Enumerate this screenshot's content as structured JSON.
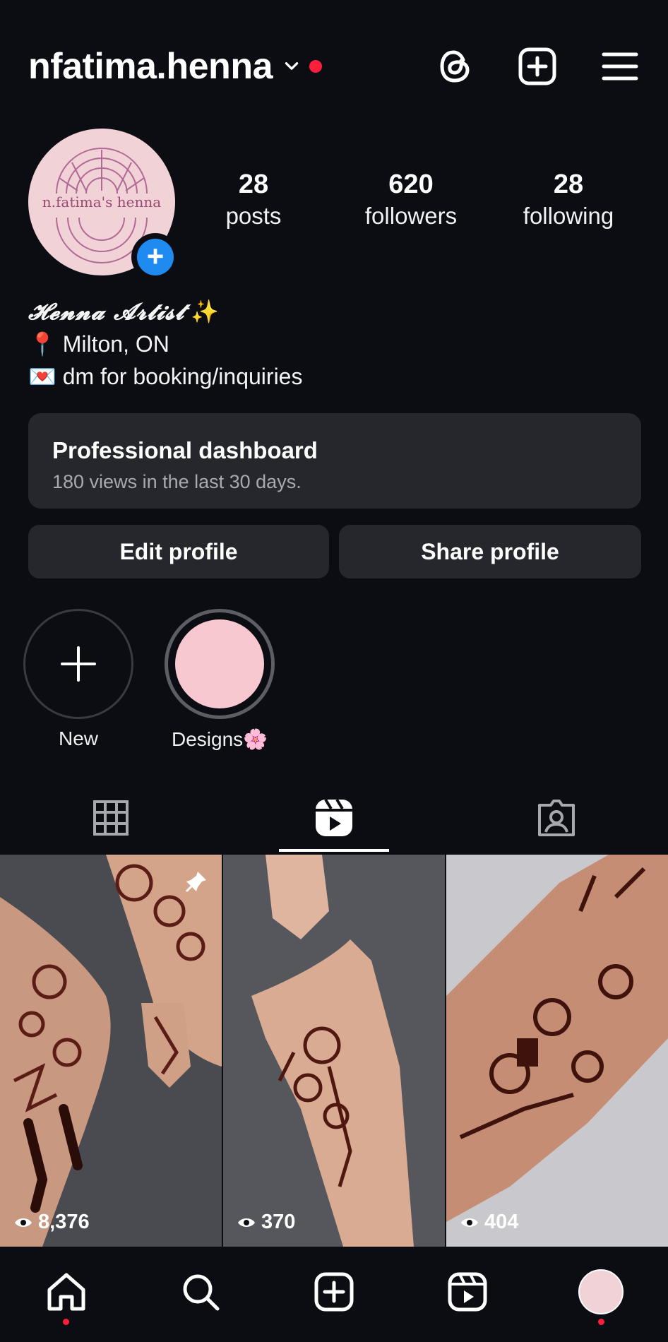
{
  "header": {
    "username": "nfatima.henna",
    "icons": [
      "threads-icon",
      "create-post-icon",
      "menu-icon"
    ]
  },
  "profile": {
    "avatar_text": "n.fatima's henna",
    "stats": [
      {
        "num": "28",
        "label": "posts"
      },
      {
        "num": "620",
        "label": "followers"
      },
      {
        "num": "28",
        "label": "following"
      }
    ],
    "bio": {
      "title": "𝓗𝓮𝓷𝓷𝓪 𝓐𝓻𝓽𝓲𝓼𝓽",
      "title_emoji": "✨",
      "location_emoji": "📍",
      "location": "Milton, ON",
      "contact_emoji": "💌",
      "contact": "dm for booking/inquiries"
    }
  },
  "dashboard": {
    "title": "Professional dashboard",
    "subtitle": "180 views in the last 30 days."
  },
  "buttons": {
    "edit": "Edit profile",
    "share": "Share profile"
  },
  "highlights": [
    {
      "label": "New"
    },
    {
      "label": "Designs🌸"
    }
  ],
  "tabs": [
    "grid-icon",
    "reels-icon",
    "tagged-icon"
  ],
  "active_tab": "reels",
  "posts": [
    {
      "views": "8,376",
      "pinned": true
    },
    {
      "views": "370",
      "pinned": false
    },
    {
      "views": "404",
      "pinned": false
    }
  ],
  "colors": {
    "background": "#0b0d12",
    "card": "#26272c",
    "accent_blue": "#1f8bf0",
    "notification_red": "#ff1f3d",
    "avatar_pink": "#f1d2d7"
  }
}
